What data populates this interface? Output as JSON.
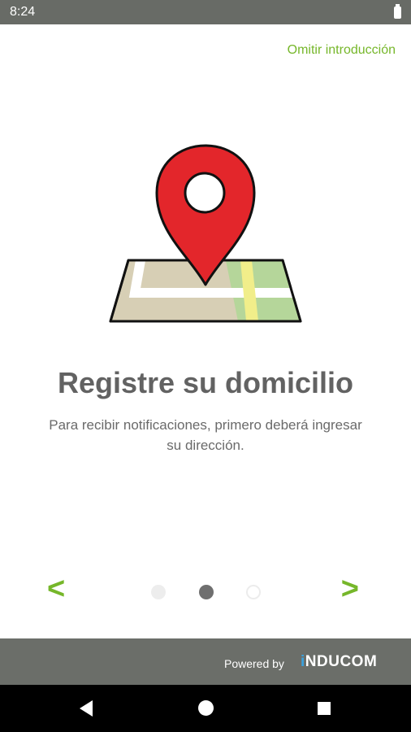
{
  "status_bar": {
    "time": "8:24",
    "battery_icon": "battery-full-icon"
  },
  "intro": {
    "skip_label": "Omitir introducción",
    "title": "Registre su domicilio",
    "subtitle": "Para recibir notificaciones, primero deberá ingresar su dirección.",
    "illustration_icon": "map-pin-icon",
    "prev_icon": "chevron-left-icon",
    "prev_glyph": "<",
    "next_icon": "chevron-right-icon",
    "next_glyph": ">",
    "pager": {
      "total": 3,
      "current": 2
    }
  },
  "footer": {
    "powered_by": "Powered by",
    "brand_prefix": "i",
    "brand_name": "NDUCOM"
  },
  "colors": {
    "accent": "#76b72a",
    "status_bar": "#686b66",
    "footer": "#6b6e69",
    "pin_red": "#e3262b",
    "text_gray": "#626262"
  }
}
